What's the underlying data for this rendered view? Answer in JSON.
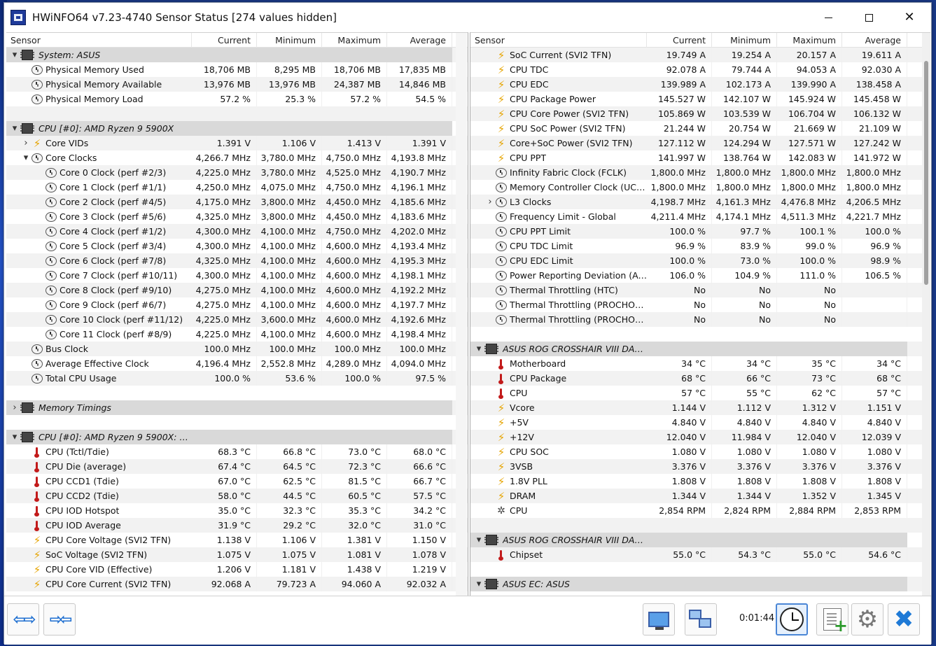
{
  "window": {
    "title": "HWiNFO64 v7.23-4740 Sensor Status [274 values hidden]"
  },
  "columns": {
    "sensor": "Sensor",
    "current": "Current",
    "minimum": "Minimum",
    "maximum": "Maximum",
    "average": "Average"
  },
  "left_rows": [
    {
      "type": "group",
      "expand": "down",
      "icon": "chip",
      "label": "System: ASUS",
      "indent": 0
    },
    {
      "type": "item",
      "icon": "clock",
      "label": "Physical Memory Used",
      "cur": "18,706 MB",
      "min": "8,295 MB",
      "max": "18,706 MB",
      "avg": "17,835 MB",
      "indent": 1
    },
    {
      "type": "item",
      "icon": "clock",
      "label": "Physical Memory Available",
      "cur": "13,976 MB",
      "min": "13,976 MB",
      "max": "24,387 MB",
      "avg": "14,846 MB",
      "indent": 1
    },
    {
      "type": "item",
      "icon": "clock",
      "label": "Physical Memory Load",
      "cur": "57.2 %",
      "min": "25.3 %",
      "max": "57.2 %",
      "avg": "54.5 %",
      "indent": 1
    },
    {
      "type": "blank"
    },
    {
      "type": "group",
      "expand": "down",
      "icon": "chip",
      "label": "CPU [#0]: AMD Ryzen 9 5900X",
      "indent": 0
    },
    {
      "type": "item",
      "expand": "right",
      "icon": "bolt",
      "label": "Core VIDs",
      "cur": "1.391 V",
      "min": "1.106 V",
      "max": "1.413 V",
      "avg": "1.391 V",
      "indent": 1
    },
    {
      "type": "item",
      "expand": "down",
      "icon": "clock",
      "label": "Core Clocks",
      "cur": "4,266.7 MHz",
      "min": "3,780.0 MHz",
      "max": "4,750.0 MHz",
      "avg": "4,193.8 MHz",
      "indent": 1
    },
    {
      "type": "item",
      "icon": "clock",
      "label": "Core 0 Clock (perf #2/3)",
      "cur": "4,225.0 MHz",
      "min": "3,780.0 MHz",
      "max": "4,525.0 MHz",
      "avg": "4,190.7 MHz",
      "indent": 2
    },
    {
      "type": "item",
      "icon": "clock",
      "label": "Core 1 Clock (perf #1/1)",
      "cur": "4,250.0 MHz",
      "min": "4,075.0 MHz",
      "max": "4,750.0 MHz",
      "avg": "4,196.1 MHz",
      "indent": 2
    },
    {
      "type": "item",
      "icon": "clock",
      "label": "Core 2 Clock (perf #4/5)",
      "cur": "4,175.0 MHz",
      "min": "3,800.0 MHz",
      "max": "4,450.0 MHz",
      "avg": "4,185.6 MHz",
      "indent": 2
    },
    {
      "type": "item",
      "icon": "clock",
      "label": "Core 3 Clock (perf #5/6)",
      "cur": "4,325.0 MHz",
      "min": "3,800.0 MHz",
      "max": "4,450.0 MHz",
      "avg": "4,183.6 MHz",
      "indent": 2
    },
    {
      "type": "item",
      "icon": "clock",
      "label": "Core 4 Clock (perf #1/2)",
      "cur": "4,300.0 MHz",
      "min": "4,100.0 MHz",
      "max": "4,750.0 MHz",
      "avg": "4,202.0 MHz",
      "indent": 2
    },
    {
      "type": "item",
      "icon": "clock",
      "label": "Core 5 Clock (perf #3/4)",
      "cur": "4,300.0 MHz",
      "min": "4,100.0 MHz",
      "max": "4,600.0 MHz",
      "avg": "4,193.4 MHz",
      "indent": 2
    },
    {
      "type": "item",
      "icon": "clock",
      "label": "Core 6 Clock (perf #7/8)",
      "cur": "4,325.0 MHz",
      "min": "4,100.0 MHz",
      "max": "4,600.0 MHz",
      "avg": "4,195.3 MHz",
      "indent": 2
    },
    {
      "type": "item",
      "icon": "clock",
      "label": "Core 7 Clock (perf #10/11)",
      "cur": "4,300.0 MHz",
      "min": "4,100.0 MHz",
      "max": "4,600.0 MHz",
      "avg": "4,198.1 MHz",
      "indent": 2
    },
    {
      "type": "item",
      "icon": "clock",
      "label": "Core 8 Clock (perf #9/10)",
      "cur": "4,275.0 MHz",
      "min": "4,100.0 MHz",
      "max": "4,600.0 MHz",
      "avg": "4,192.2 MHz",
      "indent": 2
    },
    {
      "type": "item",
      "icon": "clock",
      "label": "Core 9 Clock (perf #6/7)",
      "cur": "4,275.0 MHz",
      "min": "4,100.0 MHz",
      "max": "4,600.0 MHz",
      "avg": "4,197.7 MHz",
      "indent": 2
    },
    {
      "type": "item",
      "icon": "clock",
      "label": "Core 10 Clock (perf #11/12)",
      "cur": "4,225.0 MHz",
      "min": "3,600.0 MHz",
      "max": "4,600.0 MHz",
      "avg": "4,192.6 MHz",
      "indent": 2
    },
    {
      "type": "item",
      "icon": "clock",
      "label": "Core 11 Clock (perf #8/9)",
      "cur": "4,225.0 MHz",
      "min": "4,100.0 MHz",
      "max": "4,600.0 MHz",
      "avg": "4,198.4 MHz",
      "indent": 2
    },
    {
      "type": "item",
      "icon": "clock",
      "label": "Bus Clock",
      "cur": "100.0 MHz",
      "min": "100.0 MHz",
      "max": "100.0 MHz",
      "avg": "100.0 MHz",
      "indent": 1
    },
    {
      "type": "item",
      "icon": "clock",
      "label": "Average Effective Clock",
      "cur": "4,196.4 MHz",
      "min": "2,552.8 MHz",
      "max": "4,289.0 MHz",
      "avg": "4,094.0 MHz",
      "indent": 1
    },
    {
      "type": "item",
      "icon": "clock",
      "label": "Total CPU Usage",
      "cur": "100.0 %",
      "min": "53.6 %",
      "max": "100.0 %",
      "avg": "97.5 %",
      "indent": 1
    },
    {
      "type": "blank"
    },
    {
      "type": "group",
      "expand": "right",
      "icon": "chip",
      "label": "Memory Timings",
      "indent": 0
    },
    {
      "type": "blank"
    },
    {
      "type": "group",
      "expand": "down",
      "icon": "chip",
      "label": "CPU [#0]: AMD Ryzen 9 5900X: En...",
      "indent": 0
    },
    {
      "type": "item",
      "icon": "therm",
      "label": "CPU (Tctl/Tdie)",
      "cur": "68.3 °C",
      "min": "66.8 °C",
      "max": "73.0 °C",
      "avg": "68.0 °C",
      "indent": 1
    },
    {
      "type": "item",
      "icon": "therm",
      "label": "CPU Die (average)",
      "cur": "67.4 °C",
      "min": "64.5 °C",
      "max": "72.3 °C",
      "avg": "66.6 °C",
      "indent": 1
    },
    {
      "type": "item",
      "icon": "therm",
      "label": "CPU CCD1 (Tdie)",
      "cur": "67.0 °C",
      "min": "62.5 °C",
      "max": "81.5 °C",
      "avg": "66.7 °C",
      "indent": 1
    },
    {
      "type": "item",
      "icon": "therm",
      "label": "CPU CCD2 (Tdie)",
      "cur": "58.0 °C",
      "min": "44.5 °C",
      "max": "60.5 °C",
      "avg": "57.5 °C",
      "indent": 1
    },
    {
      "type": "item",
      "icon": "therm",
      "label": "CPU IOD Hotspot",
      "cur": "35.0 °C",
      "min": "32.3 °C",
      "max": "35.3 °C",
      "avg": "34.2 °C",
      "indent": 1
    },
    {
      "type": "item",
      "icon": "therm",
      "label": "CPU IOD Average",
      "cur": "31.9 °C",
      "min": "29.2 °C",
      "max": "32.0 °C",
      "avg": "31.0 °C",
      "indent": 1
    },
    {
      "type": "item",
      "icon": "bolt",
      "label": "CPU Core Voltage (SVI2 TFN)",
      "cur": "1.138 V",
      "min": "1.106 V",
      "max": "1.381 V",
      "avg": "1.150 V",
      "indent": 1
    },
    {
      "type": "item",
      "icon": "bolt",
      "label": "SoC Voltage (SVI2 TFN)",
      "cur": "1.075 V",
      "min": "1.075 V",
      "max": "1.081 V",
      "avg": "1.078 V",
      "indent": 1
    },
    {
      "type": "item",
      "icon": "bolt",
      "label": "CPU Core VID (Effective)",
      "cur": "1.206 V",
      "min": "1.181 V",
      "max": "1.438 V",
      "avg": "1.219 V",
      "indent": 1
    },
    {
      "type": "item",
      "icon": "bolt",
      "label": "CPU Core Current (SVI2 TFN)",
      "cur": "92.068 A",
      "min": "79.723 A",
      "max": "94.060 A",
      "avg": "92.032 A",
      "indent": 1
    }
  ],
  "right_rows": [
    {
      "type": "item",
      "icon": "bolt",
      "label": "SoC Current (SVI2 TFN)",
      "cur": "19.749 A",
      "min": "19.254 A",
      "max": "20.157 A",
      "avg": "19.611 A",
      "indent": 1
    },
    {
      "type": "item",
      "icon": "bolt",
      "label": "CPU TDC",
      "cur": "92.078 A",
      "min": "79.744 A",
      "max": "94.053 A",
      "avg": "92.030 A",
      "indent": 1
    },
    {
      "type": "item",
      "icon": "bolt",
      "label": "CPU EDC",
      "cur": "139.989 A",
      "min": "102.173 A",
      "max": "139.990 A",
      "avg": "138.458 A",
      "indent": 1
    },
    {
      "type": "item",
      "icon": "bolt",
      "label": "CPU Package Power",
      "cur": "145.527 W",
      "min": "142.107 W",
      "max": "145.924 W",
      "avg": "145.458 W",
      "indent": 1
    },
    {
      "type": "item",
      "icon": "bolt",
      "label": "CPU Core Power (SVI2 TFN)",
      "cur": "105.869 W",
      "min": "103.539 W",
      "max": "106.704 W",
      "avg": "106.132 W",
      "indent": 1
    },
    {
      "type": "item",
      "icon": "bolt",
      "label": "CPU SoC Power (SVI2 TFN)",
      "cur": "21.244 W",
      "min": "20.754 W",
      "max": "21.669 W",
      "avg": "21.109 W",
      "indent": 1
    },
    {
      "type": "item",
      "icon": "bolt",
      "label": "Core+SoC Power (SVI2 TFN)",
      "cur": "127.112 W",
      "min": "124.294 W",
      "max": "127.571 W",
      "avg": "127.242 W",
      "indent": 1
    },
    {
      "type": "item",
      "icon": "bolt",
      "label": "CPU PPT",
      "cur": "141.997 W",
      "min": "138.764 W",
      "max": "142.083 W",
      "avg": "141.972 W",
      "indent": 1
    },
    {
      "type": "item",
      "icon": "clock",
      "label": "Infinity Fabric Clock (FCLK)",
      "cur": "1,800.0 MHz",
      "min": "1,800.0 MHz",
      "max": "1,800.0 MHz",
      "avg": "1,800.0 MHz",
      "indent": 1
    },
    {
      "type": "item",
      "icon": "clock",
      "label": "Memory Controller Clock (UCLK)",
      "cur": "1,800.0 MHz",
      "min": "1,800.0 MHz",
      "max": "1,800.0 MHz",
      "avg": "1,800.0 MHz",
      "indent": 1
    },
    {
      "type": "item",
      "expand": "right",
      "icon": "clock",
      "label": "L3 Clocks",
      "cur": "4,198.7 MHz",
      "min": "4,161.3 MHz",
      "max": "4,476.8 MHz",
      "avg": "4,206.5 MHz",
      "indent": 1
    },
    {
      "type": "item",
      "icon": "clock",
      "label": "Frequency Limit - Global",
      "cur": "4,211.4 MHz",
      "min": "4,174.1 MHz",
      "max": "4,511.3 MHz",
      "avg": "4,221.7 MHz",
      "indent": 1
    },
    {
      "type": "item",
      "icon": "clock",
      "label": "CPU PPT Limit",
      "cur": "100.0 %",
      "min": "97.7 %",
      "max": "100.1 %",
      "avg": "100.0 %",
      "indent": 1
    },
    {
      "type": "item",
      "icon": "clock",
      "label": "CPU TDC Limit",
      "cur": "96.9 %",
      "min": "83.9 %",
      "max": "99.0 %",
      "avg": "96.9 %",
      "indent": 1
    },
    {
      "type": "item",
      "icon": "clock",
      "label": "CPU EDC Limit",
      "cur": "100.0 %",
      "min": "73.0 %",
      "max": "100.0 %",
      "avg": "98.9 %",
      "indent": 1
    },
    {
      "type": "item",
      "icon": "clock",
      "label": "Power Reporting Deviation (Accur...",
      "cur": "106.0 %",
      "min": "104.9 %",
      "max": "111.0 %",
      "avg": "106.5 %",
      "indent": 1
    },
    {
      "type": "item",
      "icon": "clock",
      "label": "Thermal Throttling (HTC)",
      "cur": "No",
      "min": "No",
      "max": "No",
      "avg": "",
      "indent": 1
    },
    {
      "type": "item",
      "icon": "clock",
      "label": "Thermal Throttling (PROCHOT CP...",
      "cur": "No",
      "min": "No",
      "max": "No",
      "avg": "",
      "indent": 1
    },
    {
      "type": "item",
      "icon": "clock",
      "label": "Thermal Throttling (PROCHOT EX...",
      "cur": "No",
      "min": "No",
      "max": "No",
      "avg": "",
      "indent": 1
    },
    {
      "type": "blank"
    },
    {
      "type": "group",
      "expand": "down",
      "icon": "chip",
      "label": "ASUS ROG CROSSHAIR VIII DAR...",
      "indent": 0
    },
    {
      "type": "item",
      "icon": "therm",
      "label": "Motherboard",
      "cur": "34 °C",
      "min": "34 °C",
      "max": "35 °C",
      "avg": "34 °C",
      "indent": 1
    },
    {
      "type": "item",
      "icon": "therm",
      "label": "CPU Package",
      "cur": "68 °C",
      "min": "66 °C",
      "max": "73 °C",
      "avg": "68 °C",
      "indent": 1
    },
    {
      "type": "item",
      "icon": "therm",
      "label": "CPU",
      "cur": "57 °C",
      "min": "55 °C",
      "max": "62 °C",
      "avg": "57 °C",
      "indent": 1
    },
    {
      "type": "item",
      "icon": "bolt",
      "label": "Vcore",
      "cur": "1.144 V",
      "min": "1.112 V",
      "max": "1.312 V",
      "avg": "1.151 V",
      "indent": 1
    },
    {
      "type": "item",
      "icon": "bolt",
      "label": "+5V",
      "cur": "4.840 V",
      "min": "4.840 V",
      "max": "4.840 V",
      "avg": "4.840 V",
      "indent": 1
    },
    {
      "type": "item",
      "icon": "bolt",
      "label": "+12V",
      "cur": "12.040 V",
      "min": "11.984 V",
      "max": "12.040 V",
      "avg": "12.039 V",
      "indent": 1
    },
    {
      "type": "item",
      "icon": "bolt",
      "label": "CPU SOC",
      "cur": "1.080 V",
      "min": "1.080 V",
      "max": "1.080 V",
      "avg": "1.080 V",
      "indent": 1
    },
    {
      "type": "item",
      "icon": "bolt",
      "label": "3VSB",
      "cur": "3.376 V",
      "min": "3.376 V",
      "max": "3.376 V",
      "avg": "3.376 V",
      "indent": 1
    },
    {
      "type": "item",
      "icon": "bolt",
      "label": "1.8V PLL",
      "cur": "1.808 V",
      "min": "1.808 V",
      "max": "1.808 V",
      "avg": "1.808 V",
      "indent": 1
    },
    {
      "type": "item",
      "icon": "bolt",
      "label": "DRAM",
      "cur": "1.344 V",
      "min": "1.344 V",
      "max": "1.352 V",
      "avg": "1.345 V",
      "indent": 1
    },
    {
      "type": "item",
      "icon": "fan",
      "label": "CPU",
      "cur": "2,854 RPM",
      "min": "2,824 RPM",
      "max": "2,884 RPM",
      "avg": "2,853 RPM",
      "indent": 1
    },
    {
      "type": "blank"
    },
    {
      "type": "group",
      "expand": "down",
      "icon": "chip",
      "label": "ASUS ROG CROSSHAIR VIII DAR...",
      "indent": 0
    },
    {
      "type": "item",
      "icon": "therm",
      "label": "Chipset",
      "cur": "55.0 °C",
      "min": "54.3 °C",
      "max": "55.0 °C",
      "avg": "54.6 °C",
      "indent": 1
    },
    {
      "type": "blank"
    },
    {
      "type": "group",
      "expand": "down",
      "icon": "chip",
      "label": "ASUS EC: ASUS",
      "indent": 0
    }
  ],
  "footer": {
    "timer": "0:01:44"
  },
  "icons": {
    "expand_down": "▾",
    "expand_right": "›",
    "bolt": "⚡",
    "fan": "✲"
  }
}
